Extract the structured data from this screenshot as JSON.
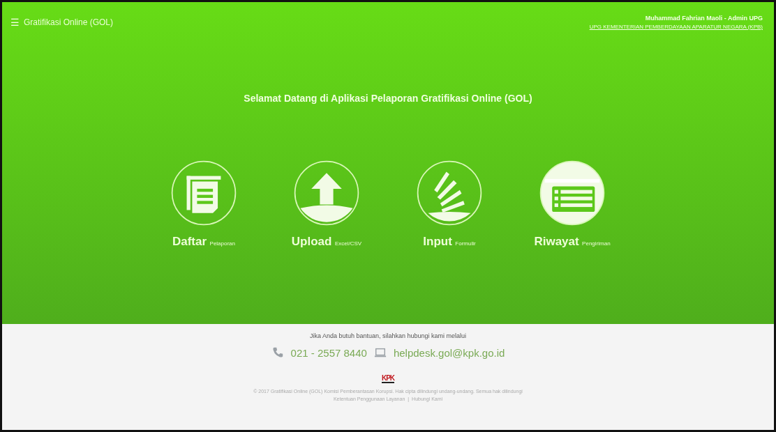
{
  "header": {
    "menu_icon": "☰",
    "title": "Gratifikasi Online (GOL)",
    "user": "Muhammad Fahrian Maoli - Admin UPG",
    "unit": "UPG KEMENTERIAN PEMBERDAYAAN APARATUR NEGARA (KPB)"
  },
  "welcome": "Selamat Datang di Aplikasi Pelaporan Gratifikasi Online (GOL)",
  "actions": [
    {
      "kind": "list",
      "label": "Daftar",
      "sub": "Pelaporan",
      "highlighted": false
    },
    {
      "kind": "upload",
      "label": "Upload",
      "sub": "Excel/CSV",
      "highlighted": false
    },
    {
      "kind": "input",
      "label": "Input",
      "sub": "Formulir",
      "highlighted": false
    },
    {
      "kind": "history",
      "label": "Riwayat",
      "sub": "Pengiriman",
      "highlighted": true
    }
  ],
  "footer": {
    "help": "Jika Anda butuh bantuan, silahkan hubungi kami melalui",
    "phone": "021 - 2557 8440",
    "email": "helpdesk.gol@kpk.go.id",
    "logo": "KPK",
    "copyright": "© 2017 Gratifikasi Online (GOL) Komisi Pemberantasan Korupsi. Hak cipta dilindungi undang-undang. Semua hak dilindungi",
    "links": [
      "Ketentuan Penggunaan Layanan",
      "Hubungi Kami"
    ],
    "link_separator": "|"
  }
}
